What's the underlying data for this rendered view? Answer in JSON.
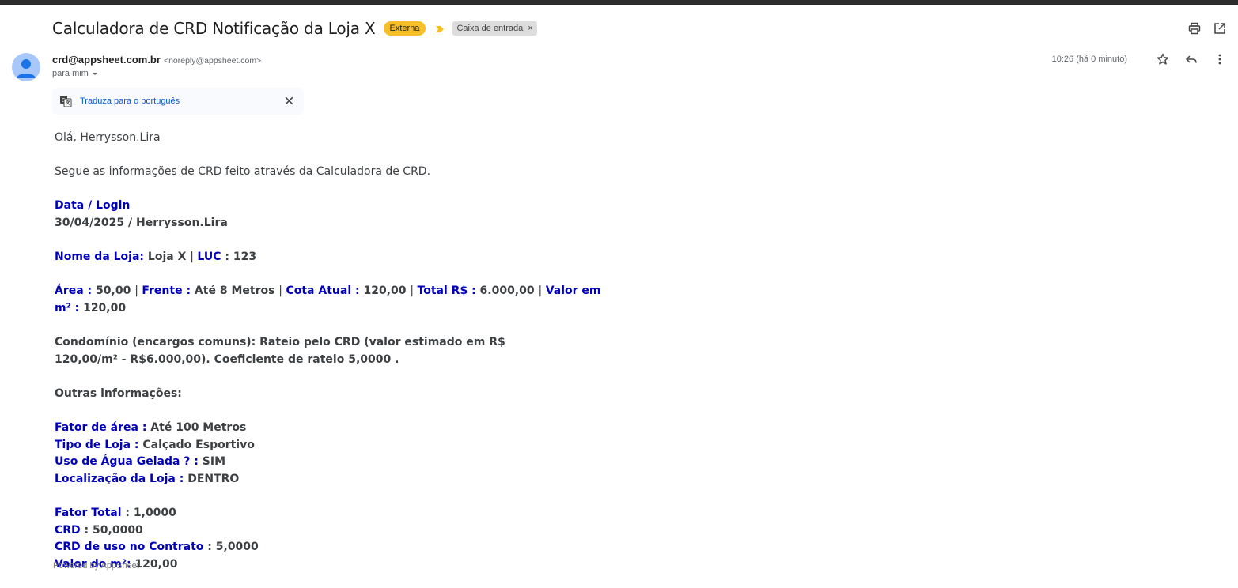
{
  "header": {
    "subject": "Calculadora de CRD Notificação da Loja X",
    "external_badge": "Externa",
    "label_chip": "Caixa de entrada",
    "label_chip_remove": "×",
    "importance_color": "#f6bf26"
  },
  "sender": {
    "name": "crd@appsheet.com.br",
    "email": "<noreply@appsheet.com>",
    "to": "para mim",
    "timestamp": "10:26 (há 0 minuto)"
  },
  "translate": {
    "label": "Traduza para o português"
  },
  "body": {
    "greeting": "Olá, Herrysson.Lira",
    "intro": "Segue as informações de CRD feito através da Calculadora de CRD.",
    "data_login_label": "Data / Login",
    "data_login_value": "30/04/2025 / Herrysson.Lira",
    "nome_loja_label": "Nome da Loja:",
    "nome_loja_value": " Loja X ",
    "luc_label": "LUC",
    "luc_value": " : 123",
    "area_label": "Área :",
    "area_value": " 50,00 ",
    "frente_label": "Frente :",
    "frente_value": " Até 8 Metros ",
    "cota_label": "Cota Atual :",
    "cota_value": " 120,00 ",
    "total_label": "Total R$ :",
    "total_value": " 6.000,00 ",
    "valor_m2_label": "Valor em m² :",
    "valor_m2_value": " 120,00",
    "condominio_line1": "Condomínio (encargos comuns): Rateio pelo CRD (valor estimado em R$",
    "condominio_line2": "120,00/m² - R$6.000,00). Coeficiente de rateio 5,0000 .",
    "outras_info": "Outras informações:",
    "fator_area_label": "Fator de área :",
    "fator_area_value": " Até 100 Metros",
    "tipo_loja_label": "Tipo de Loja :",
    "tipo_loja_value": " Calçado Esportivo",
    "agua_label": "Uso de Água Gelada ? :",
    "agua_value": " SIM",
    "localizacao_label": "Localização da Loja :",
    "localizacao_value": " DENTRO",
    "fator_total_label": "Fator Total",
    "fator_total_value": " : 1,0000",
    "crd_label": "CRD",
    "crd_value": " : 50,0000",
    "crd_contrato_label": "CRD de uso no Contrato",
    "crd_contrato_value": " : 5,0000",
    "valor_do_m2_label": "Valor do m²:",
    "valor_do_m2_value": " 120,00",
    "pipe": "|"
  },
  "footer": {
    "powered_by": "Powered by AppSheet"
  },
  "colors": {
    "label_blue": "#0000bb",
    "link_blue": "#0b57d0",
    "avatar_bg": "#a8c7fa",
    "avatar_fg": "#1a73e8"
  }
}
